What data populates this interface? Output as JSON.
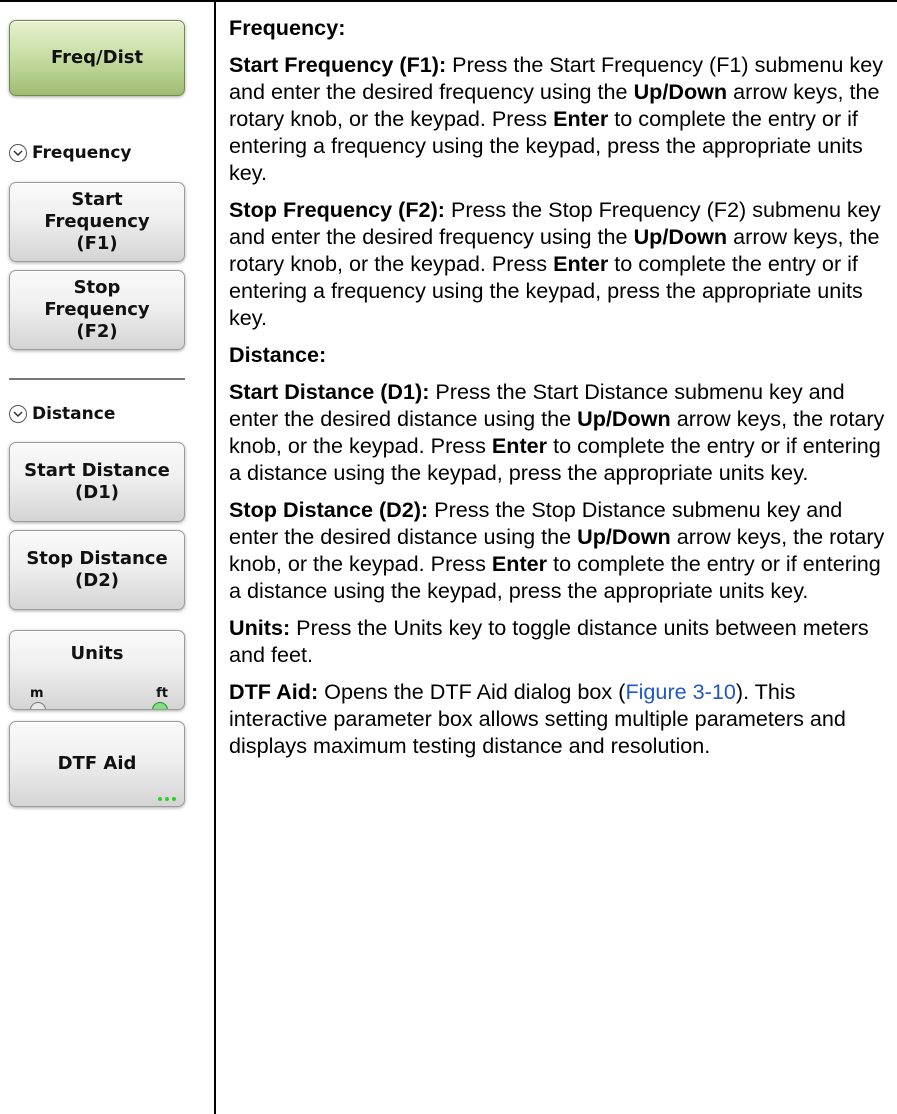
{
  "menu": {
    "freq_dist": "Freq/Dist",
    "frequency_section": "Frequency",
    "start_frequency": "Start\nFrequency\n(F1)",
    "stop_frequency": "Stop\nFrequency\n(F2)",
    "distance_section": "Distance",
    "start_distance": "Start Distance\n(D1)",
    "stop_distance": "Stop Distance\n(D2)",
    "units": "Units",
    "units_m": "m",
    "units_ft": "ft",
    "dtf_aid": "DTF Aid"
  },
  "content": {
    "frequency_heading": "Frequency:",
    "start_freq_title": "Start Frequency (F1):",
    "start_freq_text_1": " Press the Start Frequency (F1) submenu key and enter the desired frequency using the ",
    "up_down": "Up/Down",
    "start_freq_text_2": " arrow keys, the rotary knob, or the keypad.     Press ",
    "enter": "Enter",
    "start_freq_text_3": " to complete the entry or if entering a frequency using the keypad, press the appropriate units key.",
    "stop_freq_title": "Stop Frequency (F2):",
    "stop_freq_text_1": " Press the Stop Frequency (F2) submenu key and enter the desired frequency using the ",
    "stop_freq_text_2": " arrow keys, the rotary knob, or the keypad. Press ",
    "stop_freq_text_3": " to complete the entry or if entering a frequency using the keypad, press the appropriate units key.",
    "distance_heading": "Distance:",
    "start_dist_title": "Start Distance (D1):",
    "start_dist_text_1": " Press the Start Distance submenu key and enter the desired distance using the ",
    "start_dist_text_2": " arrow keys, the rotary knob, or the keypad. Press ",
    "start_dist_text_3": " to complete the entry or if entering a distance using the keypad, press the appropriate units key.",
    "stop_dist_title": "Stop Distance (D2):",
    "stop_dist_text_1": " Press the Stop Distance submenu key and enter the desired distance using the ",
    "stop_dist_text_2": " arrow keys, the rotary knob, or the keypad. Press ",
    "stop_dist_text_3": " to complete the entry or if entering a distance using the keypad, press the appropriate units key.",
    "units_title": "Units:",
    "units_text": " Press the Units key to toggle distance units between meters and feet.",
    "dtf_title": "DTF Aid:",
    "dtf_text_1": " Opens the DTF Aid dialog box (",
    "dtf_link": "Figure 3-10",
    "dtf_text_2": "). This interactive parameter box allows setting multiple parameters and displays maximum testing distance and resolution."
  }
}
